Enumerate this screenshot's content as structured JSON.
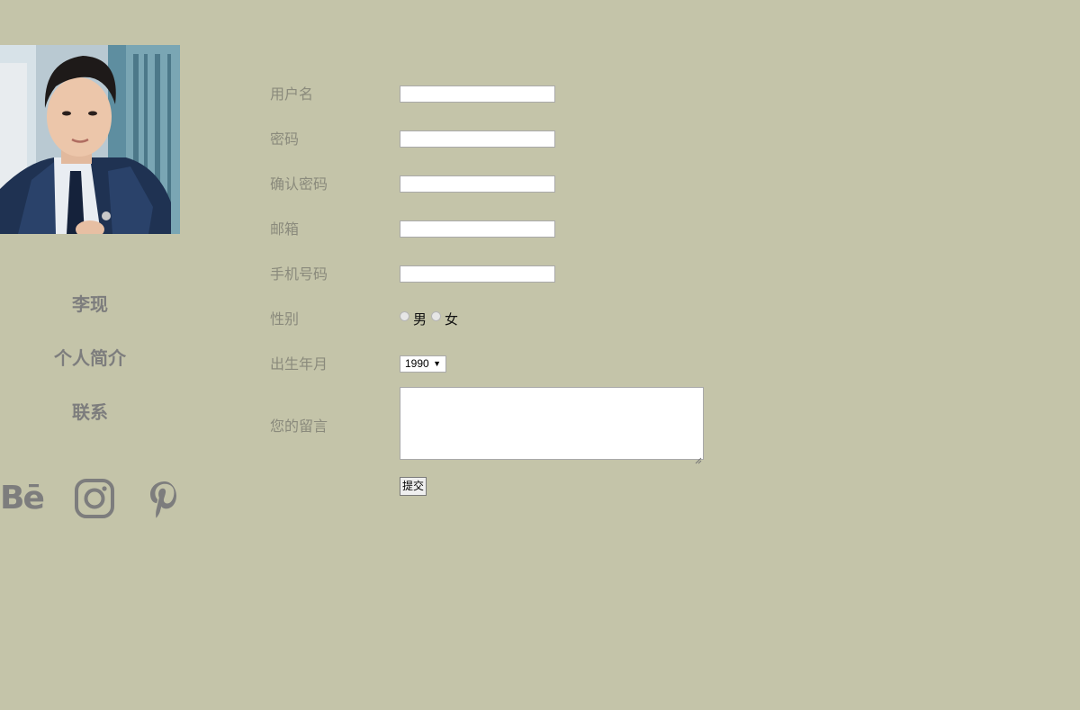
{
  "sidebar": {
    "avatar_alt": "profile photo",
    "nav": [
      {
        "label": "李现"
      },
      {
        "label": "个人简介"
      },
      {
        "label": "联系"
      }
    ],
    "social": [
      {
        "name": "behance",
        "text": "Bē"
      },
      {
        "name": "instagram"
      },
      {
        "name": "pinterest"
      }
    ]
  },
  "form": {
    "fields": [
      {
        "label": "用户名",
        "value": ""
      },
      {
        "label": "密码",
        "value": ""
      },
      {
        "label": "确认密码",
        "value": ""
      },
      {
        "label": "邮箱",
        "value": ""
      },
      {
        "label": "手机号码",
        "value": ""
      }
    ],
    "gender": {
      "label": "性别",
      "options": [
        "男",
        "女"
      ],
      "selected": null
    },
    "birth": {
      "label": "出生年月",
      "selected_value": "1990"
    },
    "message": {
      "label": "您的留言",
      "value": ""
    },
    "submit_label": "提交"
  },
  "colors": {
    "background": "#c4c4a9",
    "nav_text": "#7d7d7d",
    "label_text": "#8a8a7c"
  }
}
